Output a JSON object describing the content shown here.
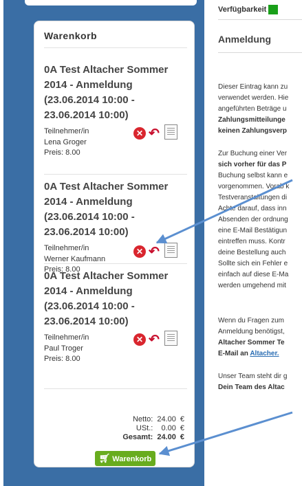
{
  "cart": {
    "title": "Warenkorb",
    "items": [
      {
        "title": "0A Test Altacher Sommer 2014 - Anmeldung (23.06.2014 10:00 - 23.06.2014 10:00)",
        "participant": "Teilnehmer/in Lena Groger",
        "price": "Preis: 8.00"
      },
      {
        "title": "0A Test Altacher Sommer 2014 - Anmeldung (23.06.2014 10:00 - 23.06.2014 10:00)",
        "participant": "Teilnehmer/in Werner Kaufmann",
        "price": "Preis: 8.00"
      },
      {
        "title": "0A Test Altacher Sommer 2014 - Anmeldung (23.06.2014 10:00 - 23.06.2014 10:00)",
        "participant": "Teilnehmer/in Paul Troger",
        "price": "Preis: 8.00"
      }
    ],
    "totals": {
      "netto_label": "Netto:",
      "netto_value": "24.00",
      "netto_currency": "€",
      "ust_label": "USt.:",
      "ust_value": "0.00",
      "ust_currency": "€",
      "gesamt_label": "Gesamt:",
      "gesamt_value": "24.00",
      "gesamt_currency": "€"
    },
    "button_label": "Warenkorb"
  },
  "content": {
    "availability_label": "Verfügbarkeit",
    "heading": "Anmeldung",
    "p1": [
      "Dieser Eintrag kann zu",
      "verwendet werden. Hie",
      "angeführten Beträge u",
      "Zahlungsmitteilunge",
      "keinen Zahlungsverp"
    ],
    "p2": [
      "Zur Buchung einer Ver",
      "sich vorher für das P",
      "Buchung selbst kann e",
      "vorgenommen. Vorab k",
      "Testveranstaltungen di",
      "Achte darauf, dass inn",
      "Absenden der ordnung",
      "eine E-Mail Bestätigun",
      "eintreffen muss. Kontr",
      "deine Bestellung auch",
      "Sollte sich ein Fehler e",
      "einfach auf diese E-Ma",
      "werden umgehend mit"
    ],
    "p3": [
      "Wenn du Fragen zum",
      "Anmeldung benötigst,",
      "Altacher Sommer Te",
      "E-Mail an"
    ],
    "p3_link": "Altacher.",
    "p4": [
      "Unser Team steht dir g",
      "Dein Team des Altac"
    ]
  },
  "colors": {
    "sidebar": "#3a6ea5",
    "button": "#68ac1e",
    "availability": "#1aa01a",
    "arrow": "#5b8fd0",
    "delete": "#d9262e"
  }
}
